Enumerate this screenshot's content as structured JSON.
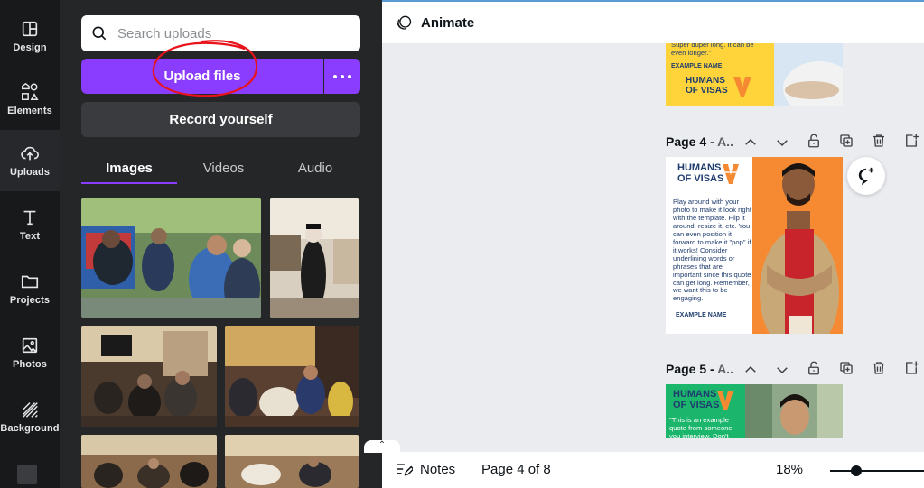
{
  "rail": {
    "items": [
      {
        "label": "Design"
      },
      {
        "label": "Elements"
      },
      {
        "label": "Uploads"
      },
      {
        "label": "Text"
      },
      {
        "label": "Projects"
      },
      {
        "label": "Photos"
      },
      {
        "label": "Background"
      }
    ],
    "active": "Uploads"
  },
  "panel": {
    "search_placeholder": "Search uploads",
    "upload_label": "Upload files",
    "record_label": "Record yourself",
    "tabs": [
      {
        "label": "Images"
      },
      {
        "label": "Videos"
      },
      {
        "label": "Audio"
      }
    ],
    "active_tab": "Images"
  },
  "topbar": {
    "animate_label": "Animate"
  },
  "pages": [
    {
      "title": "Page 4 - ",
      "suffix": "A..",
      "logo_line1": "HUMANS",
      "logo_line2": "OF VISAS",
      "quote": "Play around with your photo to make it look right with the template. Flip it around, resize it, etc. You can even position it forward to make it \"pop\" if it works! Consider underlining words or phrases that are important since this quote can get long. Remember, we want this to be engaging.",
      "example_name": "EXAMPLE NAME"
    },
    {
      "title": "Page 5 - ",
      "suffix": "A..",
      "logo_line1": "HUMANS",
      "logo_line2": "OF VISAS",
      "quote": "\"This is an example quote from someone you interview. Don't"
    }
  ],
  "prev_page": {
    "quote": "Super duper long. It can be even longer.\"",
    "example_name": "EXAMPLE NAME",
    "logo_line1": "HUMANS",
    "logo_line2": "OF VISAS"
  },
  "bottombar": {
    "notes_label": "Notes",
    "page_indicator": "Page 4 of 8",
    "zoom": "18%"
  },
  "colors": {
    "accent": "#8b3dff",
    "rail_bg": "#18191b",
    "panel_bg": "#252627",
    "canvas_bg": "#ebecf0",
    "brand_orange": "#f58a32",
    "brand_yellow": "#ffd43b",
    "brand_green": "#1bb56b",
    "brand_navy": "#1f3c6e"
  }
}
